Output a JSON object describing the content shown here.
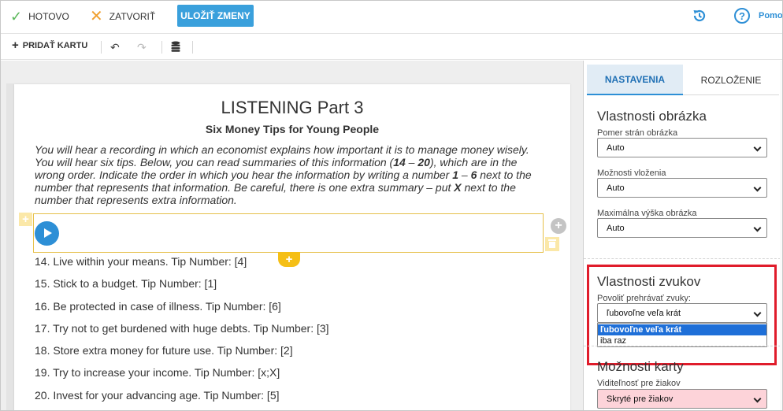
{
  "toolbar": {
    "done_label": "HOTOVO",
    "close_label": "ZATVORIŤ",
    "save_label": "ULOŽIŤ ZMENY",
    "help_label": "Pomo"
  },
  "subtoolbar": {
    "add_card_label": "PRIDAŤ KARTU"
  },
  "page": {
    "title": "LISTENING Part 3",
    "subtitle": "Six Money Tips for Young People",
    "instruction_parts": [
      "You will hear a recording in which an economist explains how important it is to manage money wisely. You will hear six tips. Below, you can read summaries of this information (",
      "14",
      " – ",
      "20",
      "), which are in the wrong order. Indicate the order in which you hear the information by writing a number ",
      "1",
      " – ",
      "6",
      " next to the number that represents that information. Be careful, there is one extra summary – put ",
      "X",
      " next to the number that represents extra information."
    ],
    "items": [
      "14. Live within your means. Tip Number: [4]",
      "15. Stick to a budget. Tip Number: [1]",
      "16. Be protected in case of illness. Tip Number: [6]",
      "17. Try not to get burdened with huge debts. Tip Number: [3]",
      "18. Store extra money for future use. Tip Number: [2]",
      "19. Try to increase your income. Tip Number: [x;X]",
      "20. Invest for your advancing age. Tip Number: [5]"
    ]
  },
  "panel": {
    "tabs": [
      "NASTAVENIA",
      "ROZLOŽENIE"
    ],
    "image_section": {
      "title": "Vlastnosti obrázka",
      "fields": [
        {
          "label": "Pomer strán obrázka",
          "value": "Auto"
        },
        {
          "label": "Možnosti vloženia",
          "value": "Auto"
        },
        {
          "label": "Maximálna výška obrázka",
          "value": "Auto"
        }
      ]
    },
    "sound_section": {
      "title": "Vlastnosti zvukov",
      "field_label": "Povoliť prehrávať zvuky:",
      "value": "ľubovoľne veľa krát",
      "options": [
        "ľubovoľne veľa krát",
        "iba raz"
      ]
    },
    "card_section": {
      "title": "Možnosti karty",
      "field_label": "Viditeľnosť pre žiakov",
      "value": "Skryté pre žiakov"
    }
  },
  "colors": {
    "accent": "#3aa0dc",
    "highlight_red": "#e01c2b",
    "audio_border": "#e6c04a",
    "add_tab": "#f5bf16",
    "hidden_pink": "#fdd3d9"
  }
}
